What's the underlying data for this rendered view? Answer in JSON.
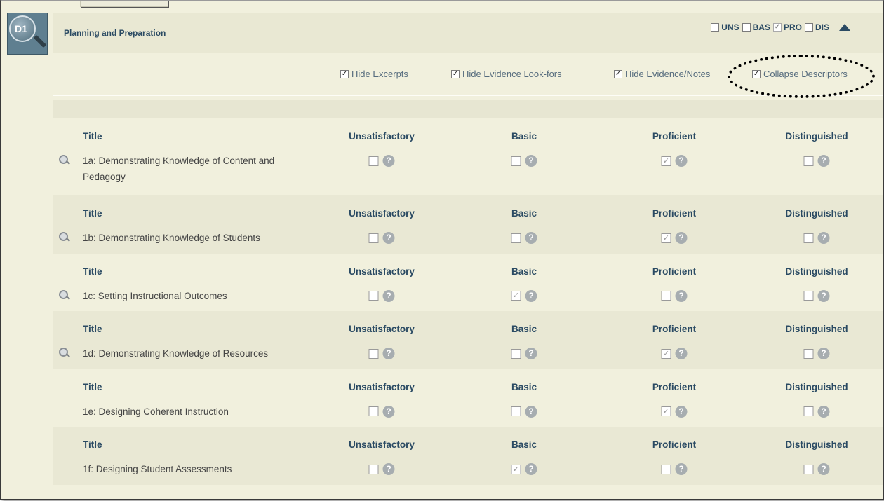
{
  "domain": {
    "badge": "D1",
    "title": "Planning and Preparation"
  },
  "levels": [
    {
      "code": "UNS",
      "checked": false,
      "dim": false
    },
    {
      "code": "BAS",
      "checked": false,
      "dim": false
    },
    {
      "code": "PRO",
      "checked": true,
      "dim": true
    },
    {
      "code": "DIS",
      "checked": false,
      "dim": false
    }
  ],
  "options": [
    {
      "label": "Hide Excerpts",
      "checked": true
    },
    {
      "label": "Hide Evidence Look-fors",
      "checked": true
    },
    {
      "label": "Hide Evidence/Notes",
      "checked": true
    },
    {
      "label": "Collapse Descriptors",
      "checked": true
    }
  ],
  "columns": {
    "title": "Title",
    "ratings": [
      "Unsatisfactory",
      "Basic",
      "Proficient",
      "Distinguished"
    ]
  },
  "components": [
    {
      "title": "1a: Demonstrating Knowledge of Content and Pedagogy",
      "has_magnifier": true,
      "checked": [
        false,
        false,
        true,
        false
      ]
    },
    {
      "title": "1b: Demonstrating Knowledge of Students",
      "has_magnifier": true,
      "checked": [
        false,
        false,
        true,
        false
      ]
    },
    {
      "title": "1c: Setting Instructional Outcomes",
      "has_magnifier": true,
      "checked": [
        false,
        true,
        false,
        false
      ]
    },
    {
      "title": "1d: Demonstrating Knowledge of Resources",
      "has_magnifier": true,
      "checked": [
        false,
        false,
        true,
        false
      ]
    },
    {
      "title": "1e: Designing Coherent Instruction",
      "has_magnifier": false,
      "checked": [
        false,
        false,
        true,
        false
      ]
    },
    {
      "title": "1f: Designing Student Assessments",
      "has_magnifier": false,
      "checked": [
        false,
        true,
        false,
        false
      ]
    }
  ],
  "help_glyph": "?",
  "colors": {
    "accent": "#2a4a63",
    "panel": "#f1f0dd",
    "row_alt": "#e9e8d4",
    "badge": "#5f7f90"
  }
}
